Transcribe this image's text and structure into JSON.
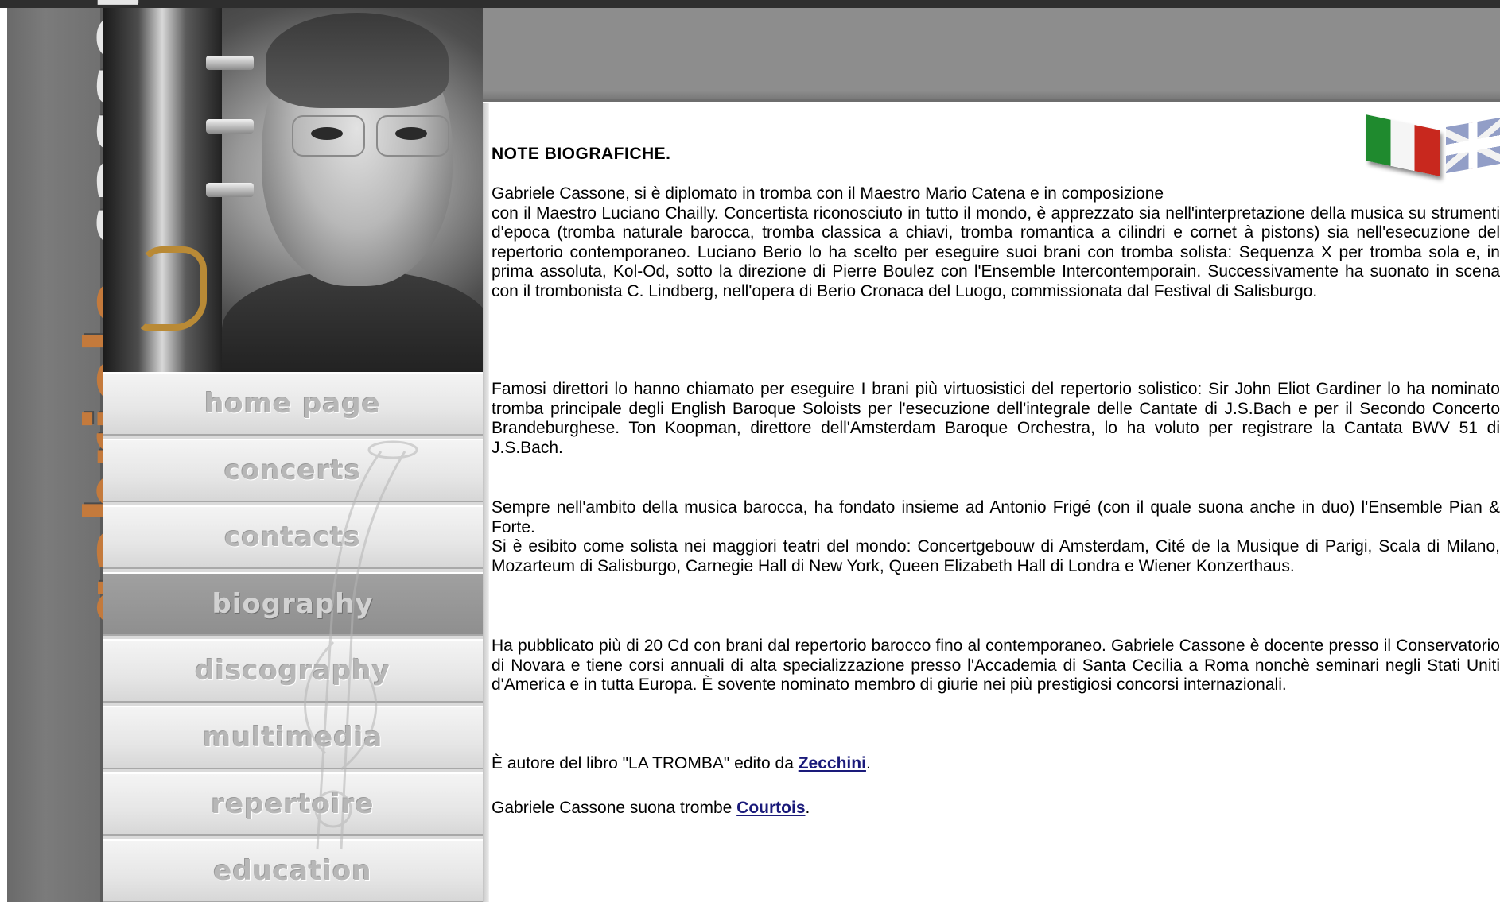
{
  "site": {
    "name_first": "gabriele",
    "name_last": "cassone"
  },
  "nav": {
    "items": [
      {
        "label": "home page",
        "active": false
      },
      {
        "label": "concerts",
        "active": false
      },
      {
        "label": "contacts",
        "active": false
      },
      {
        "label": "biography",
        "active": true
      },
      {
        "label": "discography",
        "active": false
      },
      {
        "label": "multimedia",
        "active": false
      },
      {
        "label": "repertoire",
        "active": false
      },
      {
        "label": "education",
        "active": false
      }
    ]
  },
  "language_flags": [
    {
      "icon": "italy-flag-icon"
    },
    {
      "icon": "uk-flag-icon"
    }
  ],
  "content": {
    "title": "NOTE BIOGRAFICHE.",
    "p1_line1": "Gabriele Cassone, si è diplomato in tromba con il Maestro Mario Catena e in composizione",
    "p1_rest": "con il Maestro Luciano Chailly. Concertista riconosciuto in tutto il mondo, è apprezzato sia nell'interpretazione della musica su strumenti d'epoca (tromba naturale barocca, tromba classica a chiavi, tromba romantica a cilindri e cornet à pistons) sia nell'esecuzione del repertorio contemporaneo. Luciano Berio lo ha scelto per eseguire suoi brani con tromba solista: Sequenza X per tromba sola e, in prima assoluta, Kol-Od, sotto la direzione di Pierre Boulez con l'Ensemble Intercontemporain. Successivamente ha suonato in scena con il trombonista C. Lindberg, nell'opera di Berio Cronaca del Luogo, commissionata dal Festival di Salisburgo.",
    "p2": "Famosi direttori lo hanno chiamato per eseguire I brani più virtuosistici del repertorio solistico: Sir John Eliot Gardiner lo ha nominato tromba principale degli English Baroque Soloists per l'esecuzione dell'integrale delle Cantate di J.S.Bach e per il Secondo Concerto Brandeburghese. Ton Koopman, direttore dell'Amsterdam Baroque Orchestra, lo ha voluto per registrare la Cantata BWV 51 di J.S.Bach.",
    "p3": "Sempre nell'ambito della musica barocca, ha fondato insieme ad Antonio Frigé (con il quale suona anche in duo) l'Ensemble Pian & Forte.",
    "p4": "Si è esibito come solista nei maggiori teatri del mondo: Concertgebouw di Amsterdam, Cité de la Musique di Parigi, Scala di Milano, Mozarteum di Salisburgo, Carnegie Hall di New York, Queen Elizabeth Hall di Londra e Wiener Konzerthaus.",
    "p5": "Ha pubblicato più di 20 Cd con brani dal repertorio barocco fino al contemporaneo. Gabriele Cassone è docente presso il Conservatorio di Novara e tiene corsi annuali di alta specializzazione presso l'Accademia di Santa Cecilia a Roma nonchè seminari negli Stati Uniti d'America e in tutta Europa. È sovente nominato membro di giurie nei più prestigiosi concorsi internazionali.",
    "p6_prefix": "È autore del libro \"LA TROMBA\" edito da ",
    "p6_link": "Zecchini",
    "p6_suffix": ".",
    "p7_prefix": "Gabriele Cassone suona trombe ",
    "p7_link": "Courtois",
    "p7_suffix": "."
  },
  "colors": {
    "accent_name": "#c47a3c",
    "header_bar": "#8d8d8d",
    "link": "#1a1a7a"
  }
}
